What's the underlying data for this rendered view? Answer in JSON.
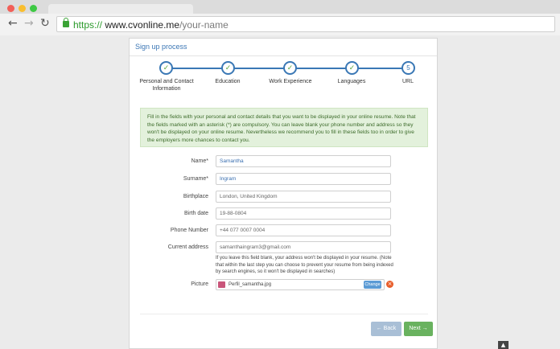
{
  "browser": {
    "back_icon": "←",
    "forward_icon": "→",
    "reload_icon": "↻",
    "url_protocol": "https://",
    "url_host": "www.cvonline.me",
    "url_path": "/your-name",
    "dot_colors": [
      "#f25f58",
      "#f9be2f",
      "#3ec944"
    ]
  },
  "panel": {
    "title": "Sign up process"
  },
  "steps": [
    {
      "label": "Personal and Contact Information",
      "status": "done",
      "icon": "check-icon"
    },
    {
      "label": "Education",
      "status": "done",
      "icon": "check-icon"
    },
    {
      "label": "Work Experience",
      "status": "done",
      "icon": "check-icon"
    },
    {
      "label": "Languages",
      "status": "done",
      "icon": "check-icon"
    },
    {
      "label": "URL",
      "status": "current",
      "number": "5"
    }
  ],
  "info_text": "Fill in the fields with your personal and contact details that you want to be displayed in your online resume. Note that the fields marked with an asterisk (*) are compulsory. You can leave blank your phone number and address so they won't be displayed on your online resume. Nevertheless we recommend you to fill in these fields too in order to give the employers more chances to contact you.",
  "form": {
    "name_label": "Name*",
    "name_value": "Samantha",
    "surname_label": "Surname*",
    "surname_value": "Ingram",
    "birthplace_label": "Birthplace",
    "birthplace_value": "London, United Kingdom",
    "birthdate_label": "Birth date",
    "birthdate_value": "19-88-0804",
    "phone_label": "Phone Number",
    "phone_value": "+44 077 0007 0004",
    "address_label": "Current address",
    "address_value": "samanthaingram3@gmail.com",
    "address_hint": "If you leave this field blank, your address won't be displayed in your resume. (Note that within the last step you can choose to prevent your resume from being indexed by search engines, so it won't be displayed in searches)",
    "picture_label": "Picture",
    "picture_file": "Perfil_samantha.jpg",
    "change_label": "Change",
    "remove_icon": "×"
  },
  "buttons": {
    "back_label": "← Back",
    "next_label": "Next →"
  },
  "scroll_top_icon": "▲"
}
